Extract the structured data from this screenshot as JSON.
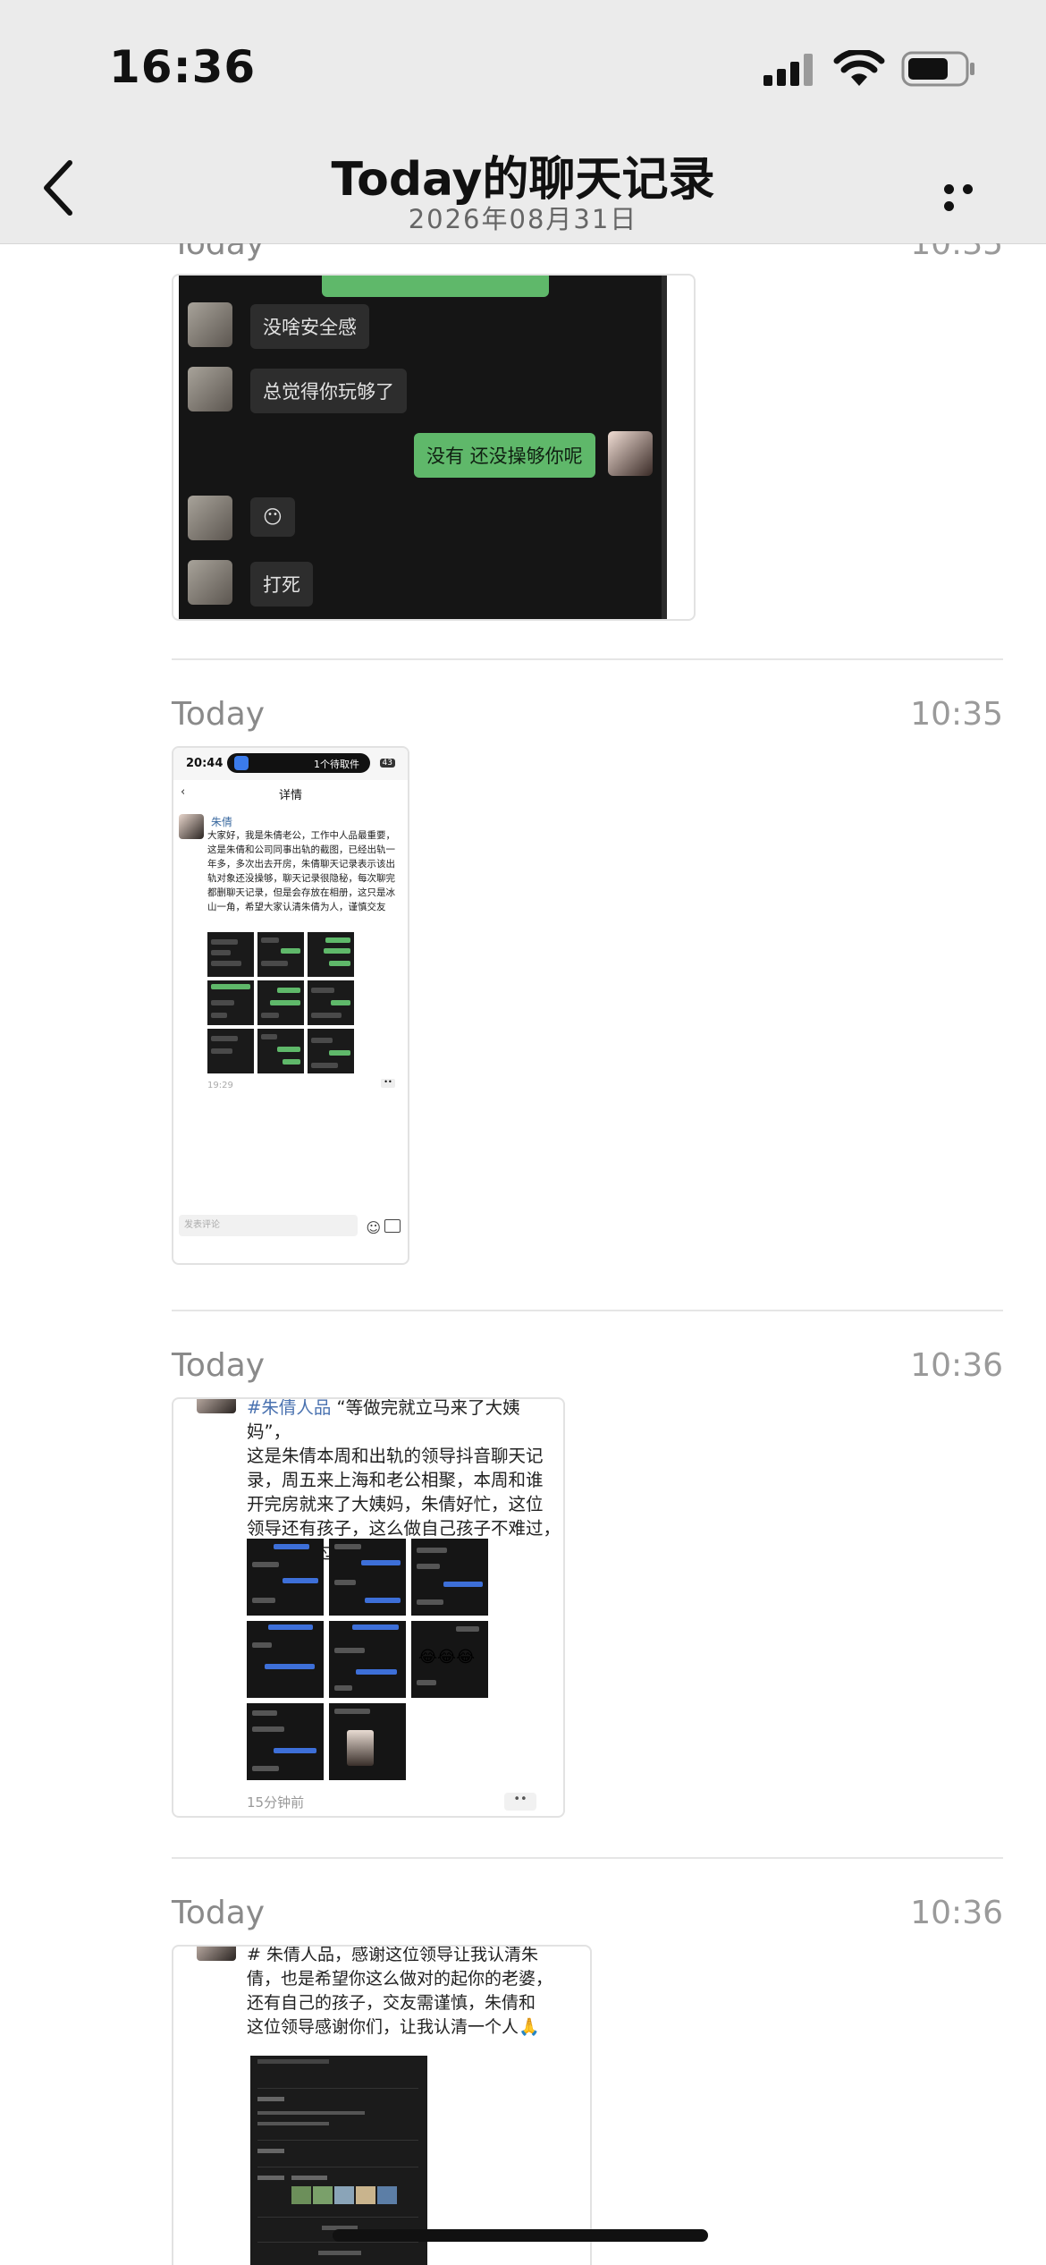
{
  "status": {
    "time": "16:36"
  },
  "nav": {
    "title": "Today的聊天记录",
    "subtitle": "2026年08月31日"
  },
  "records": [
    {
      "label": "Today",
      "time": "10:35",
      "chat": {
        "messages": [
          {
            "side": "left",
            "text": "没啥安全感"
          },
          {
            "side": "left",
            "text": "总觉得你玩够了"
          },
          {
            "side": "right",
            "text": "没有 还没操够你呢"
          },
          {
            "side": "left",
            "text": "😶"
          },
          {
            "side": "left",
            "text": "打死"
          }
        ]
      }
    },
    {
      "label": "Today",
      "time": "10:35",
      "phone": {
        "time": "20:44",
        "island": "1个待取件",
        "battery": "43",
        "page_title": "详情",
        "author": "朱倩",
        "text": "大家好，我是朱倩老公，工作中人品最重要，这是朱倩和公司同事出轨的截图，已经出轨一年多，多次出去开房，朱倩聊天记录表示该出轨对象还没操够，聊天记录很隐秘，每次聊完都删聊天记录，但是会存放在相册，这只是冰山一角，希望大家认清朱倩为人，谨慎交友",
        "when": "19:29",
        "comment_placeholder": "发表评论"
      }
    },
    {
      "label": "Today",
      "time": "10:36",
      "post": {
        "hashtag": "#朱倩人品",
        "lines": [
          " “等做完就立马来了大姨妈”，",
          "这是朱倩本周和出轨的领导抖音聊天记",
          "录，周五来上海和老公相聚，本周和谁",
          "开完房就来了大姨妈，朱倩好忙，这位",
          "领导还有孩子，这么做自己孩子不难过，",
          "妻子不难过吗"
        ],
        "ago": "15分钟前"
      }
    },
    {
      "label": "Today",
      "time": "10:36",
      "post": {
        "lines": [
          "# 朱倩人品，感谢这位领导让我认清朱",
          "倩，也是希望你这么做对的起你的老婆，",
          "还有自己的孩子，交友需谨慎，朱倩和",
          "这位领导感谢你们，让我认清一个人🙏"
        ]
      }
    }
  ],
  "colors": {
    "bar_bg": "#ebebeb",
    "wechat_green": "#5fb86a",
    "hashtag": "#4a72b0"
  }
}
